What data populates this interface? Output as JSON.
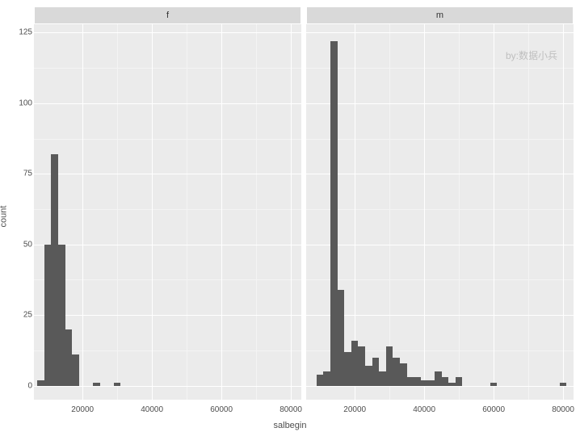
{
  "chart_data": {
    "type": "bar",
    "facets": [
      "f",
      "m"
    ],
    "title": "",
    "xlabel": "salbegin",
    "ylabel": "count",
    "xlim": [
      6000,
      83000
    ],
    "ylim": [
      -5,
      128
    ],
    "y_ticks": [
      0,
      25,
      50,
      75,
      100,
      125
    ],
    "x_ticks": [
      20000,
      40000,
      60000,
      80000
    ],
    "bin_width": 2000,
    "series": [
      {
        "name": "f",
        "x": [
          8000,
          10000,
          12000,
          14000,
          16000,
          18000,
          24000,
          28000,
          30000
        ],
        "values": [
          2,
          50,
          82,
          50,
          20,
          11,
          1,
          0,
          1
        ]
      },
      {
        "name": "m",
        "x": [
          8000,
          10000,
          12000,
          14000,
          16000,
          18000,
          20000,
          22000,
          24000,
          26000,
          28000,
          30000,
          32000,
          34000,
          36000,
          38000,
          40000,
          42000,
          44000,
          46000,
          48000,
          50000,
          60000,
          80000
        ],
        "values": [
          0,
          4,
          5,
          122,
          34,
          12,
          16,
          14,
          7,
          10,
          5,
          14,
          10,
          8,
          3,
          3,
          2,
          2,
          5,
          3,
          1,
          3,
          1,
          1
        ]
      }
    ],
    "watermark": "by:数据小兵"
  }
}
